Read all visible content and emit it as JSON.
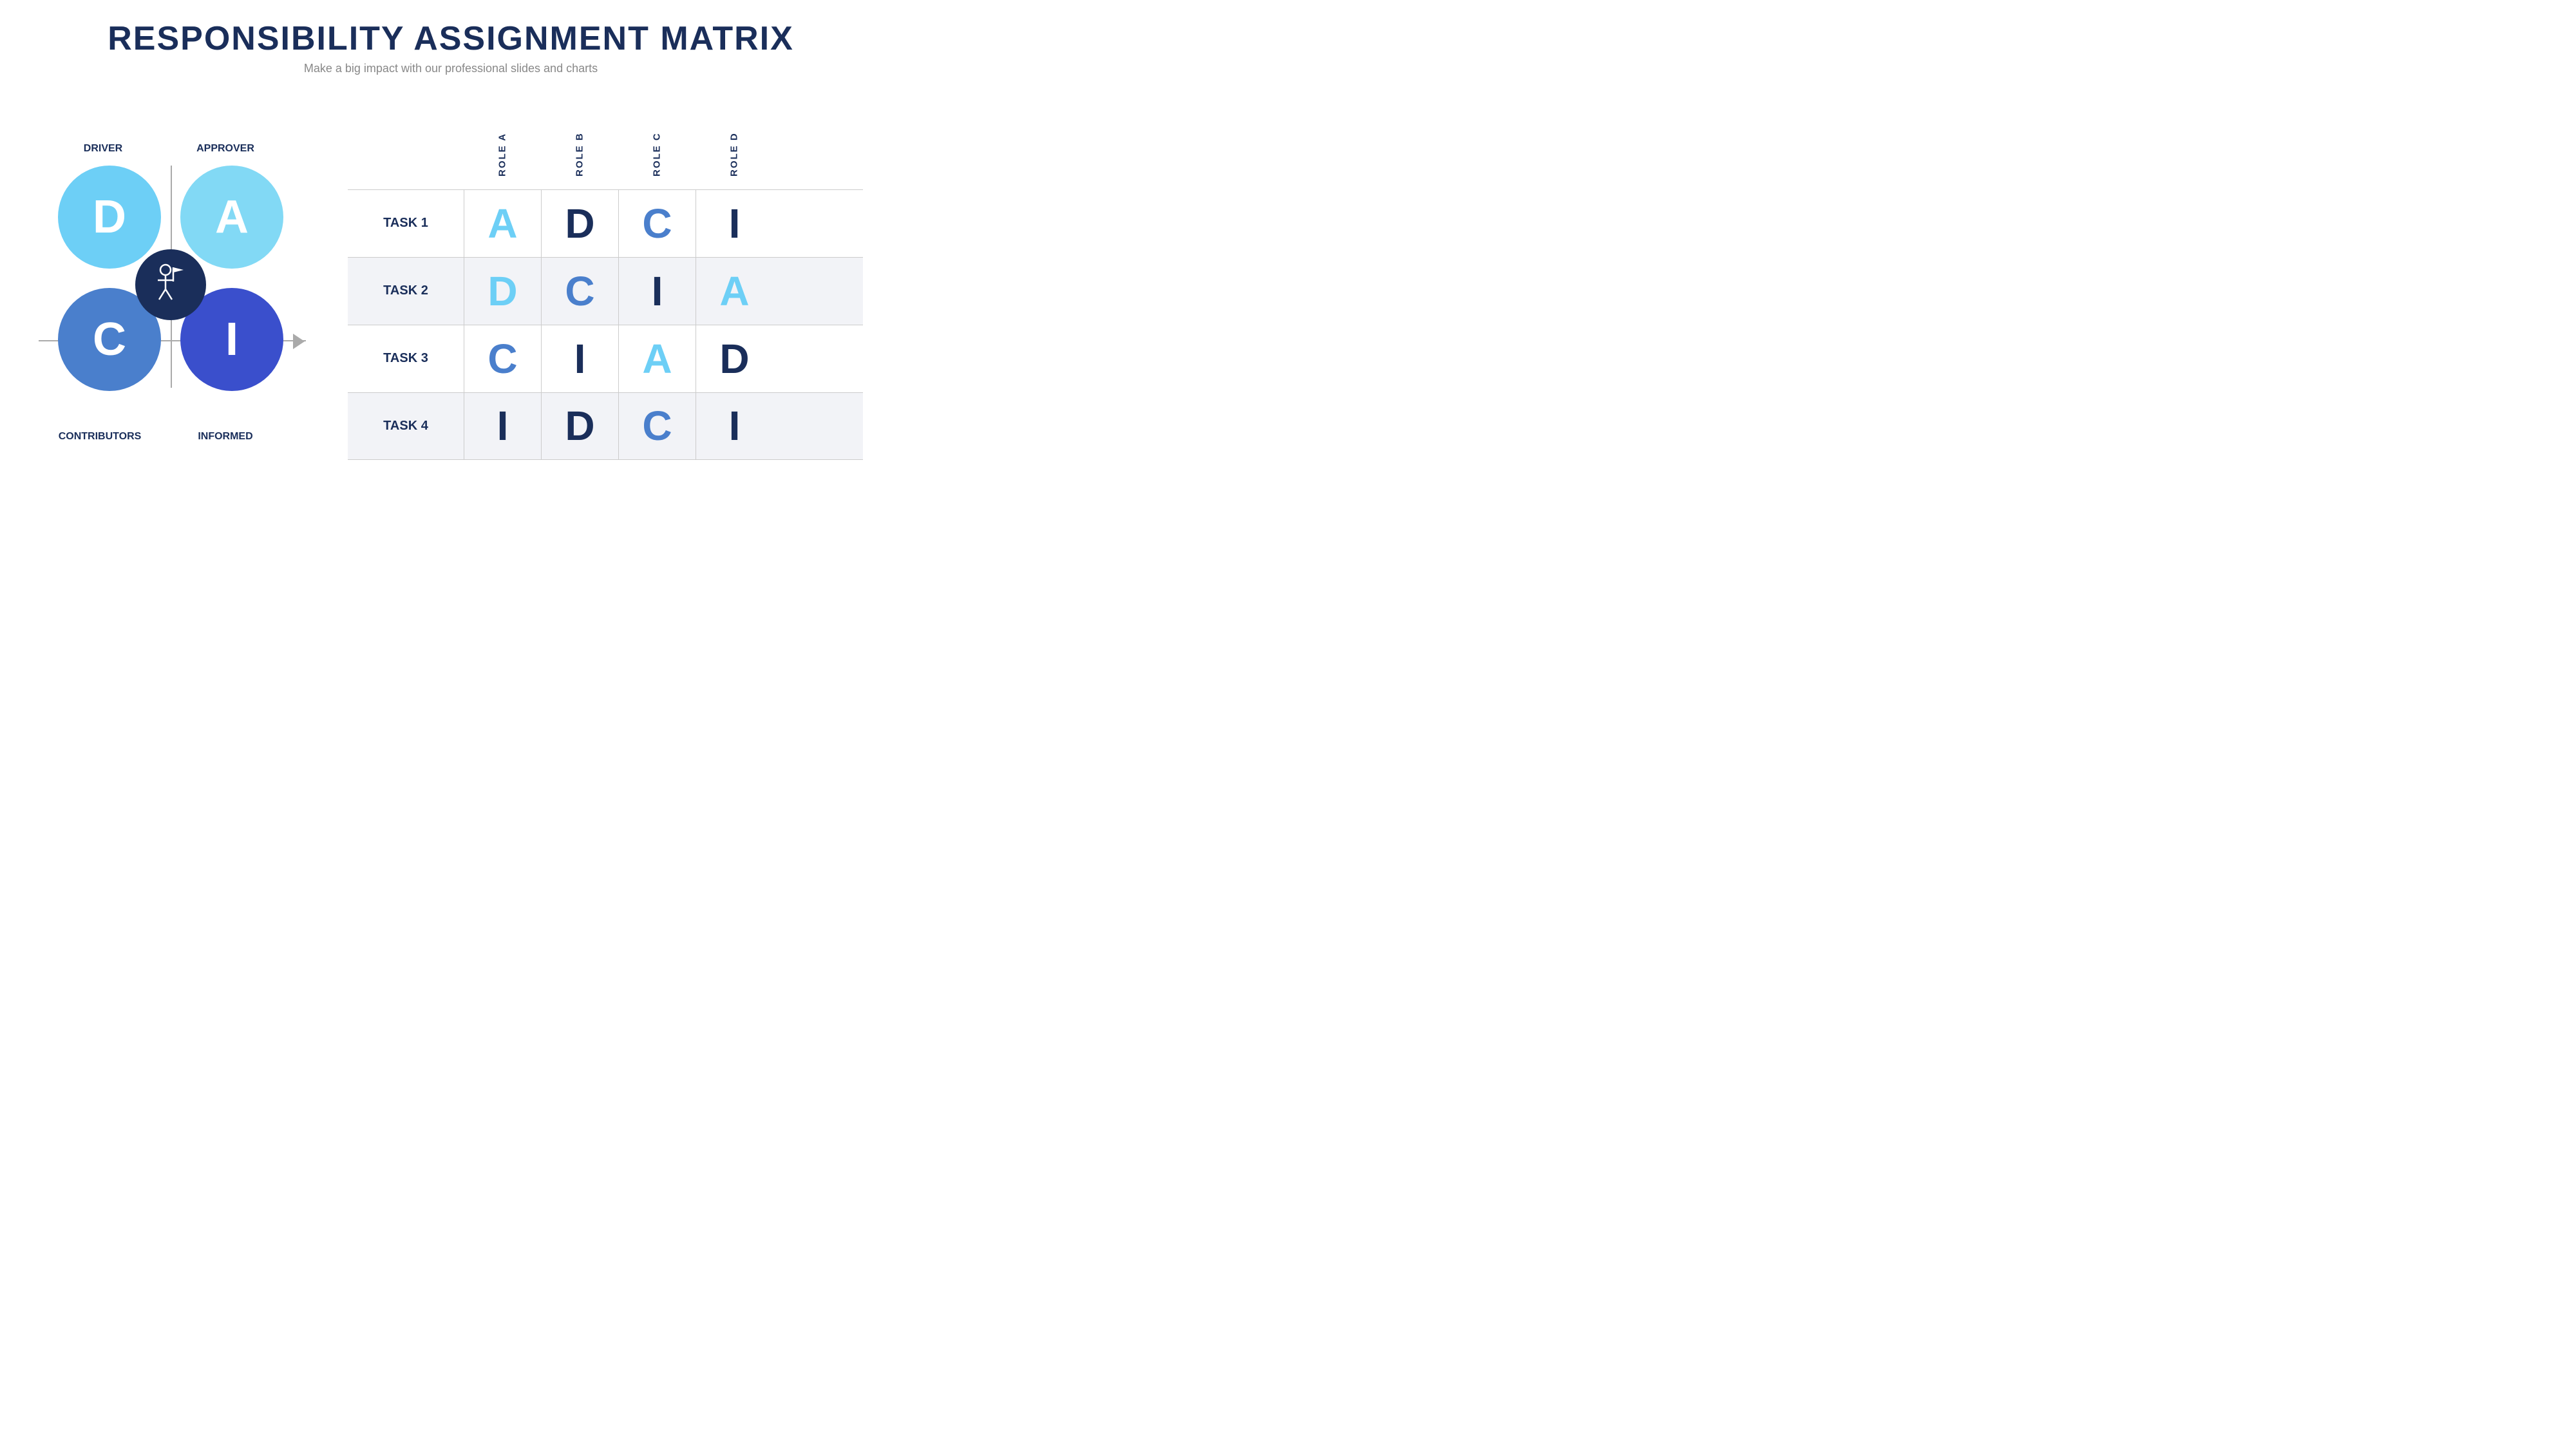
{
  "header": {
    "title": "RESPONSIBILITY ASSIGNMENT MATRIX",
    "subtitle": "Make a big impact with our professional slides and charts"
  },
  "diagram": {
    "labels": {
      "driver": "DRIVER",
      "approver": "APPROVER",
      "contributors": "CONTRIBUTORS",
      "informed": "INFORMED"
    },
    "circles": {
      "d": "D",
      "a": "A",
      "c": "C",
      "i": "I"
    }
  },
  "matrix": {
    "roles": [
      "ROLE A",
      "ROLE B",
      "ROLE C",
      "ROLE D"
    ],
    "rows": [
      {
        "task": "TASK 1",
        "shaded": false,
        "cells": [
          {
            "value": "A",
            "colorClass": "color-light-blue"
          },
          {
            "value": "D",
            "colorClass": "color-dark-navy"
          },
          {
            "value": "C",
            "colorClass": "color-medium-blue"
          },
          {
            "value": "I",
            "colorClass": "color-dark-navy"
          }
        ]
      },
      {
        "task": "TASK 2",
        "shaded": true,
        "cells": [
          {
            "value": "D",
            "colorClass": "color-light-blue"
          },
          {
            "value": "C",
            "colorClass": "color-medium-blue"
          },
          {
            "value": "I",
            "colorClass": "color-dark-navy"
          },
          {
            "value": "A",
            "colorClass": "color-light-blue"
          }
        ]
      },
      {
        "task": "TASK 3",
        "shaded": false,
        "cells": [
          {
            "value": "C",
            "colorClass": "color-medium-blue"
          },
          {
            "value": "I",
            "colorClass": "color-dark-navy"
          },
          {
            "value": "A",
            "colorClass": "color-light-blue"
          },
          {
            "value": "D",
            "colorClass": "color-dark-navy"
          }
        ]
      },
      {
        "task": "TASK 4",
        "shaded": true,
        "cells": [
          {
            "value": "I",
            "colorClass": "color-dark-navy"
          },
          {
            "value": "D",
            "colorClass": "color-dark-navy"
          },
          {
            "value": "C",
            "colorClass": "color-medium-blue"
          },
          {
            "value": "I",
            "colorClass": "color-dark-navy"
          }
        ]
      }
    ]
  }
}
